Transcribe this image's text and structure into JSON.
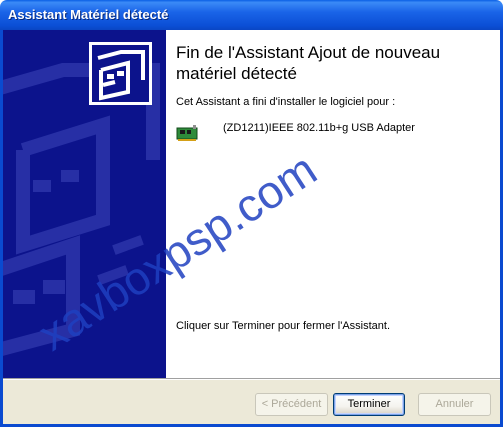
{
  "window": {
    "title": "Assistant Matériel détecté"
  },
  "content": {
    "heading": "Fin de l'Assistant Ajout de nouveau matériel détecté",
    "intro": "Cet Assistant a fini d'installer le logiciel pour :",
    "device_name": "(ZD1211)IEEE 802.11b+g USB Adapter",
    "device_icon": "network-card-icon",
    "finish_text": "Cliquer sur Terminer pour fermer l'Assistant."
  },
  "buttons": {
    "previous": "< Précédent",
    "finish": "Terminer",
    "cancel": "Annuler"
  },
  "watermark": "xavboxpsp.com",
  "colors": {
    "titlebar": "#0b4fd6",
    "banner": "#0c138c",
    "footer": "#ece9d8",
    "watermark": "#1f3fbf"
  }
}
